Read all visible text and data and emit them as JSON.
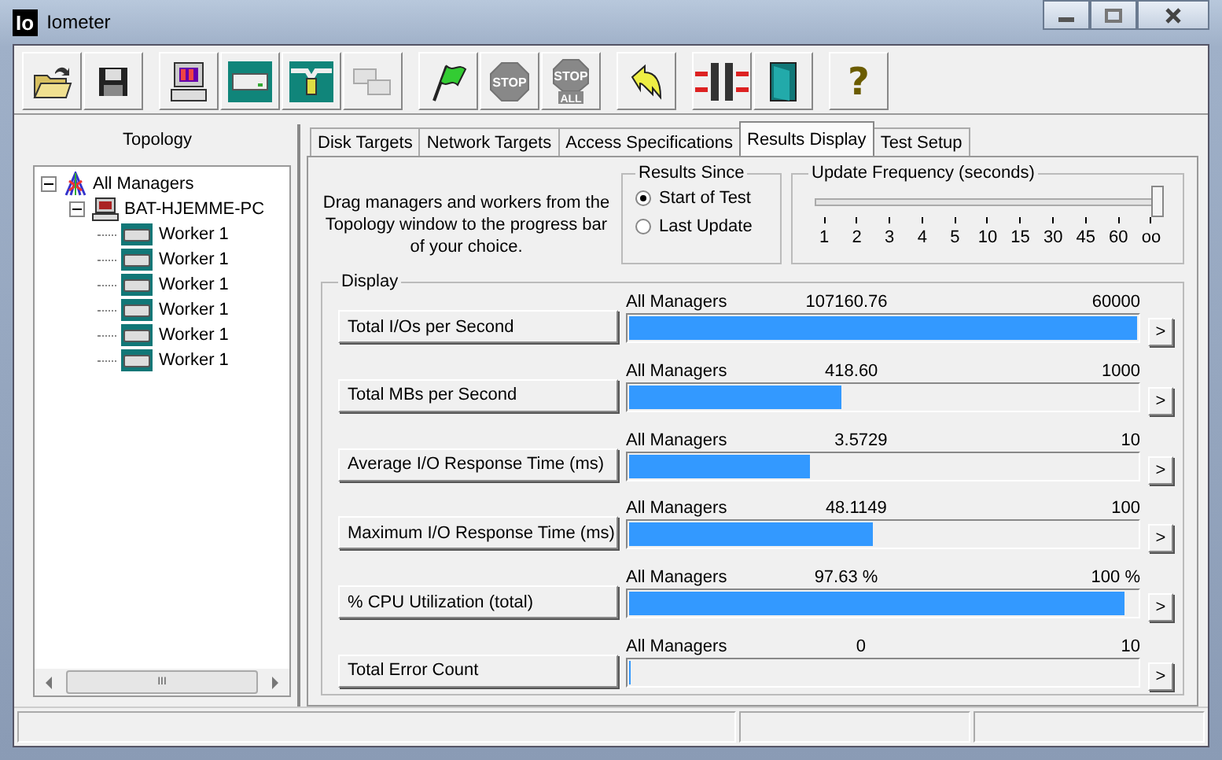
{
  "window": {
    "logo": "Io",
    "title": "Iometer"
  },
  "toolbar": [
    [
      {
        "kind": "open",
        "disabled": false
      },
      {
        "kind": "save",
        "disabled": false
      }
    ],
    [
      {
        "kind": "computer",
        "disabled": false
      },
      {
        "kind": "disk",
        "disabled": false
      },
      {
        "kind": "network",
        "disabled": false
      },
      {
        "kind": "windows",
        "disabled": true
      }
    ],
    [
      {
        "kind": "flag",
        "disabled": false
      },
      {
        "kind": "stop",
        "text": "STOP",
        "disabled": true
      },
      {
        "kind": "stop-all",
        "text": "STOP",
        "subtext": "ALL",
        "disabled": true
      }
    ],
    [
      {
        "kind": "back",
        "disabled": false
      }
    ],
    [
      {
        "kind": "split",
        "disabled": false
      },
      {
        "kind": "door",
        "disabled": false
      }
    ],
    [
      {
        "kind": "help",
        "text": "?",
        "disabled": false
      }
    ]
  ],
  "topology": {
    "title": "Topology",
    "tree": [
      {
        "label": "All Managers",
        "kind": "managers",
        "expanded": true,
        "children": [
          {
            "label": "BAT-HJEMME-PC",
            "kind": "computer",
            "expanded": true,
            "children": [
              {
                "label": "Worker 1",
                "kind": "worker"
              },
              {
                "label": "Worker 1",
                "kind": "worker"
              },
              {
                "label": "Worker 1",
                "kind": "worker"
              },
              {
                "label": "Worker 1",
                "kind": "worker"
              },
              {
                "label": "Worker 1",
                "kind": "worker"
              },
              {
                "label": "Worker 1",
                "kind": "worker"
              }
            ]
          }
        ]
      }
    ],
    "scroll_grip": "III"
  },
  "tabs": [
    {
      "label": "Disk Targets",
      "selected": false
    },
    {
      "label": "Network Targets",
      "selected": false
    },
    {
      "label": "Access Specifications",
      "selected": false
    },
    {
      "label": "Results Display",
      "selected": true
    },
    {
      "label": "Test Setup",
      "selected": false
    }
  ],
  "instructions": "Drag managers and workers from the Topology window to the progress bar of your choice.",
  "results_since": {
    "title": "Results Since",
    "options": [
      {
        "label": "Start of Test",
        "selected": true
      },
      {
        "label": "Last Update",
        "selected": false
      }
    ]
  },
  "update_frequency": {
    "title": "Update Frequency (seconds)",
    "level": 1,
    "ticks": [
      "1",
      "2",
      "3",
      "4",
      "5",
      "10",
      "15",
      "30",
      "45",
      "60",
      "oo"
    ]
  },
  "display": {
    "title": "Display",
    "rows": [
      {
        "button": "Total I/Os per Second",
        "source": "All Managers",
        "value": "107160.76",
        "max": "60000",
        "level": 1,
        "more": ">"
      },
      {
        "button": "Total MBs per Second",
        "source": "All Managers",
        "value": "418.60",
        "max": "1000",
        "level": 0.4186,
        "more": ">"
      },
      {
        "button": "Average I/O Response Time (ms)",
        "source": "All Managers",
        "value": "3.5729",
        "max": "10",
        "level": 0.3573,
        "more": ">"
      },
      {
        "button": "Maximum I/O Response Time (ms)",
        "source": "All Managers",
        "value": "48.1149",
        "max": "100",
        "level": 0.4811,
        "more": ">"
      },
      {
        "button": "% CPU Utilization (total)",
        "source": "All Managers",
        "value": "97.63 %",
        "max": "100 %",
        "level": 0.9763,
        "more": ">"
      },
      {
        "button": "Total Error Count",
        "source": "All Managers",
        "value": "0",
        "max": "10",
        "level": 0,
        "more": ">"
      }
    ]
  }
}
